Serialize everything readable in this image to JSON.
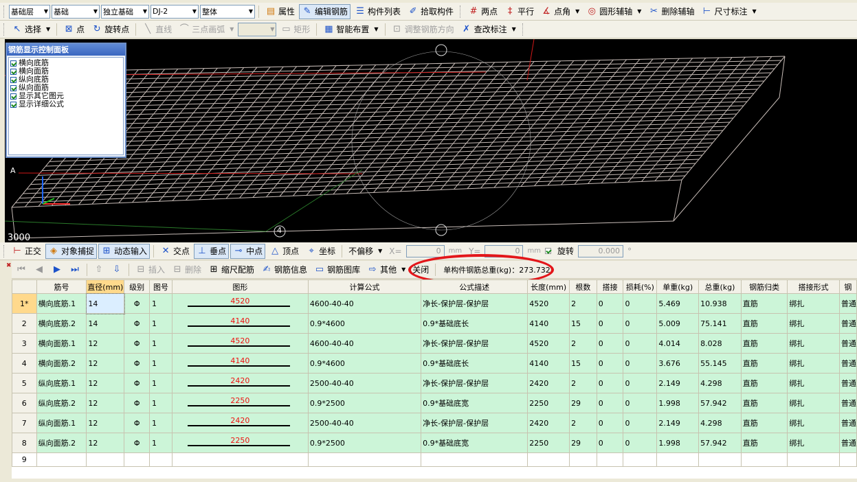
{
  "toolbar1": {
    "floor": "基础层",
    "category": "基础",
    "type": "独立基础",
    "component": "DJ-2",
    "part": "整体",
    "property": "属性",
    "edit_rebar": "编辑钢筋",
    "component_list": "构件列表",
    "pick_component": "拾取构件",
    "two_points": "两点",
    "parallel": "平行",
    "point_angle": "点角",
    "circle_aux": "圆形辅轴",
    "delete_aux": "删除辅轴",
    "dimension": "尺寸标注"
  },
  "toolbar2": {
    "select": "选择",
    "point": "点",
    "rotate_point": "旋转点",
    "line": "直线",
    "three_point_arc": "三点画弧",
    "rect": "矩形",
    "smart_layout": "智能布置",
    "adjust_direction": "调整钢筋方向",
    "edit_annotation": "查改标注"
  },
  "viewport": {
    "axis_a": "A",
    "axis_4": "4",
    "dimension": "3000",
    "colors": {
      "rebar": "#c8bdb8",
      "red_line": "#d01818",
      "green_line": "#2a7a2a",
      "bg": "#000000"
    }
  },
  "panel": {
    "title": "钢筋显示控制面板",
    "options": [
      "横向底筋",
      "横向面筋",
      "纵向底筋",
      "纵向面筋",
      "显示其它图元",
      "显示详细公式"
    ]
  },
  "toolbar3": {
    "ortho": "正交",
    "snap": "对象捕捉",
    "dynamic_input": "动态输入",
    "intersection": "交点",
    "perpendicular": "垂点",
    "midpoint": "中点",
    "vertex": "顶点",
    "coordinate": "坐标",
    "offset": "不偏移",
    "x_label": "X=",
    "x_value": "0",
    "mm": "mm",
    "y_label": "Y=",
    "y_value": "0",
    "rotate": "旋转",
    "rotate_value": "0.000",
    "degree": "°"
  },
  "toolbar4": {
    "insert": "插入",
    "delete": "删除",
    "scale_rebar": "缩尺配筋",
    "rebar_info": "钢筋信息",
    "rebar_library": "钢筋图库",
    "other": "其他",
    "close": "关闭",
    "total_weight": "单构件钢筋总重(kg)：273.732"
  },
  "grid": {
    "headers": [
      "筋号",
      "直径(mm)",
      "级别",
      "图号",
      "图形",
      "计算公式",
      "公式描述",
      "长度(mm)",
      "根数",
      "搭接",
      "损耗(%)",
      "单重(kg)",
      "总重(kg)",
      "钢筋归类",
      "搭接形式",
      "钢"
    ],
    "rows": [
      {
        "num": "1*",
        "name": "横向底筋.1",
        "dia": "14",
        "grade": "Φ",
        "fig": "1",
        "shape": "4520",
        "formula": "4600-40-40",
        "desc": "净长-保护层-保护层",
        "len": "4520",
        "count": "2",
        "lap": "0",
        "loss": "0",
        "unit_w": "5.469",
        "total_w": "10.938",
        "cls": "直筋",
        "lap_type": "绑扎",
        "last": "普通"
      },
      {
        "num": "2",
        "name": "横向底筋.2",
        "dia": "14",
        "grade": "Φ",
        "fig": "1",
        "shape": "4140",
        "formula": "0.9*4600",
        "desc": "0.9*基础底长",
        "len": "4140",
        "count": "15",
        "lap": "0",
        "loss": "0",
        "unit_w": "5.009",
        "total_w": "75.141",
        "cls": "直筋",
        "lap_type": "绑扎",
        "last": "普通"
      },
      {
        "num": "3",
        "name": "横向面筋.1",
        "dia": "12",
        "grade": "Φ",
        "fig": "1",
        "shape": "4520",
        "formula": "4600-40-40",
        "desc": "净长-保护层-保护层",
        "len": "4520",
        "count": "2",
        "lap": "0",
        "loss": "0",
        "unit_w": "4.014",
        "total_w": "8.028",
        "cls": "直筋",
        "lap_type": "绑扎",
        "last": "普通"
      },
      {
        "num": "4",
        "name": "横向面筋.2",
        "dia": "12",
        "grade": "Φ",
        "fig": "1",
        "shape": "4140",
        "formula": "0.9*4600",
        "desc": "0.9*基础底长",
        "len": "4140",
        "count": "15",
        "lap": "0",
        "loss": "0",
        "unit_w": "3.676",
        "total_w": "55.145",
        "cls": "直筋",
        "lap_type": "绑扎",
        "last": "普通"
      },
      {
        "num": "5",
        "name": "纵向底筋.1",
        "dia": "12",
        "grade": "Φ",
        "fig": "1",
        "shape": "2420",
        "formula": "2500-40-40",
        "desc": "净长-保护层-保护层",
        "len": "2420",
        "count": "2",
        "lap": "0",
        "loss": "0",
        "unit_w": "2.149",
        "total_w": "4.298",
        "cls": "直筋",
        "lap_type": "绑扎",
        "last": "普通"
      },
      {
        "num": "6",
        "name": "纵向底筋.2",
        "dia": "12",
        "grade": "Φ",
        "fig": "1",
        "shape": "2250",
        "formula": "0.9*2500",
        "desc": "0.9*基础底宽",
        "len": "2250",
        "count": "29",
        "lap": "0",
        "loss": "0",
        "unit_w": "1.998",
        "total_w": "57.942",
        "cls": "直筋",
        "lap_type": "绑扎",
        "last": "普通"
      },
      {
        "num": "7",
        "name": "纵向面筋.1",
        "dia": "12",
        "grade": "Φ",
        "fig": "1",
        "shape": "2420",
        "formula": "2500-40-40",
        "desc": "净长-保护层-保护层",
        "len": "2420",
        "count": "2",
        "lap": "0",
        "loss": "0",
        "unit_w": "2.149",
        "total_w": "4.298",
        "cls": "直筋",
        "lap_type": "绑扎",
        "last": "普通"
      },
      {
        "num": "8",
        "name": "纵向面筋.2",
        "dia": "12",
        "grade": "Φ",
        "fig": "1",
        "shape": "2250",
        "formula": "0.9*2500",
        "desc": "0.9*基础底宽",
        "len": "2250",
        "count": "29",
        "lap": "0",
        "loss": "0",
        "unit_w": "1.998",
        "total_w": "57.942",
        "cls": "直筋",
        "lap_type": "绑扎",
        "last": "普通"
      }
    ],
    "empty_row": "9"
  }
}
